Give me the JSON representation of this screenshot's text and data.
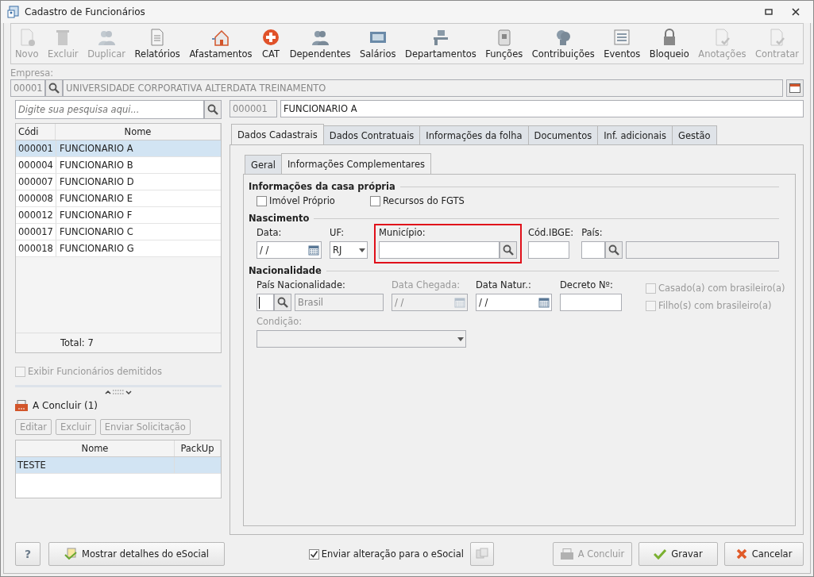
{
  "window": {
    "title": "Cadastro de Funcionários"
  },
  "toolbar": [
    {
      "label": "Novo",
      "disabled": true
    },
    {
      "label": "Excluir",
      "disabled": true
    },
    {
      "label": "Duplicar",
      "disabled": true
    },
    {
      "label": "Relatórios",
      "disabled": false
    },
    {
      "label": "Afastamentos",
      "disabled": false
    },
    {
      "label": "CAT",
      "disabled": false
    },
    {
      "label": "Dependentes",
      "disabled": false
    },
    {
      "label": "Salários",
      "disabled": false
    },
    {
      "label": "Departamentos",
      "disabled": false
    },
    {
      "label": "Funções",
      "disabled": false
    },
    {
      "label": "Contribuições",
      "disabled": false
    },
    {
      "label": "Eventos",
      "disabled": false
    },
    {
      "label": "Bloqueio",
      "disabled": false
    },
    {
      "label": "Anotações",
      "disabled": true
    },
    {
      "label": "Contratar",
      "disabled": true
    }
  ],
  "empresa": {
    "label": "Empresa:",
    "code": "00001",
    "name": "UNIVERSIDADE CORPORATIVA ALTERDATA TREINAMENTO"
  },
  "search": {
    "placeholder": "Digite sua pesquisa aqui..."
  },
  "employees": {
    "columns": [
      "Códi",
      "Nome"
    ],
    "rows": [
      {
        "code": "000001",
        "name": "FUNCIONARIO A",
        "selected": true
      },
      {
        "code": "000004",
        "name": "FUNCIONARIO B",
        "selected": false
      },
      {
        "code": "000007",
        "name": "FUNCIONARIO D",
        "selected": false
      },
      {
        "code": "000008",
        "name": "FUNCIONARIO E",
        "selected": false
      },
      {
        "code": "000012",
        "name": "FUNCIONARIO F",
        "selected": false
      },
      {
        "code": "000017",
        "name": "FUNCIONARIO C",
        "selected": false
      },
      {
        "code": "000018",
        "name": "FUNCIONARIO G",
        "selected": false
      }
    ],
    "total": "Total: 7"
  },
  "show_dismissed": {
    "label": "Exibir Funcionários demitidos",
    "checked": false,
    "disabled": true
  },
  "pending": {
    "title": "A Concluir (1)",
    "buttons": [
      {
        "label": "Editar",
        "disabled": true
      },
      {
        "label": "Excluir",
        "disabled": true
      },
      {
        "label": "Enviar Solicitação",
        "disabled": true
      }
    ],
    "columns": [
      "Nome",
      "PackUp"
    ],
    "rows": [
      {
        "name": "TESTE",
        "selected": true
      }
    ]
  },
  "employee": {
    "code": "000001",
    "name": "FUNCIONARIO A"
  },
  "tabs": [
    {
      "label": "Dados Cadastrais",
      "selected": true
    },
    {
      "label": "Dados Contratuais",
      "selected": false
    },
    {
      "label": "Informações da folha",
      "selected": false
    },
    {
      "label": "Documentos",
      "selected": false
    },
    {
      "label": "Inf. adicionais",
      "selected": false
    },
    {
      "label": "Gestão",
      "selected": false
    }
  ],
  "subtabs": [
    {
      "label": "Geral",
      "selected": false
    },
    {
      "label": "Informações Complementares",
      "selected": true
    }
  ],
  "casa": {
    "title": "Informações da casa própria",
    "checkboxes": [
      {
        "label": "Imóvel Próprio",
        "checked": false
      },
      {
        "label": "Recursos do FGTS",
        "checked": false
      }
    ]
  },
  "nascimento": {
    "title": "Nascimento",
    "data": {
      "label": "Data:",
      "value": "/ /"
    },
    "uf": {
      "label": "UF:",
      "value": "RJ"
    },
    "municipio": {
      "label": "Município:",
      "highlighted": true
    },
    "cod_ibge": {
      "label": "Cód.IBGE:"
    },
    "pais": {
      "label": "País:"
    }
  },
  "nacionalidade": {
    "title": "Nacionalidade",
    "pais": {
      "label": "País Nacionalidade:",
      "value": "Brasil"
    },
    "data_chegada": {
      "label": "Data Chegada:",
      "value": "/ /",
      "disabled": true
    },
    "data_natur": {
      "label": "Data Natur.:",
      "value": "/ /",
      "disabled": false
    },
    "decreto": {
      "label": "Decreto Nº:"
    },
    "checkboxes": [
      {
        "label": "Casado(a) com brasileiro(a)",
        "checked": false,
        "disabled": true
      },
      {
        "label": "Filho(s) com brasileiro(a)",
        "checked": false,
        "disabled": true
      }
    ],
    "condicao": {
      "label": "Condição:",
      "disabled": true
    }
  },
  "footer": {
    "help": "?",
    "esocial": "Mostrar detalhes do eSocial",
    "send": {
      "label": "Enviar alteração para o eSocial",
      "checked": true
    },
    "buttons": [
      {
        "label": "A Concluir",
        "kind": "conclude",
        "disabled": true
      },
      {
        "label": "Gravar",
        "kind": "save",
        "disabled": false
      },
      {
        "label": "Cancelar",
        "kind": "cancel",
        "disabled": false
      }
    ]
  }
}
